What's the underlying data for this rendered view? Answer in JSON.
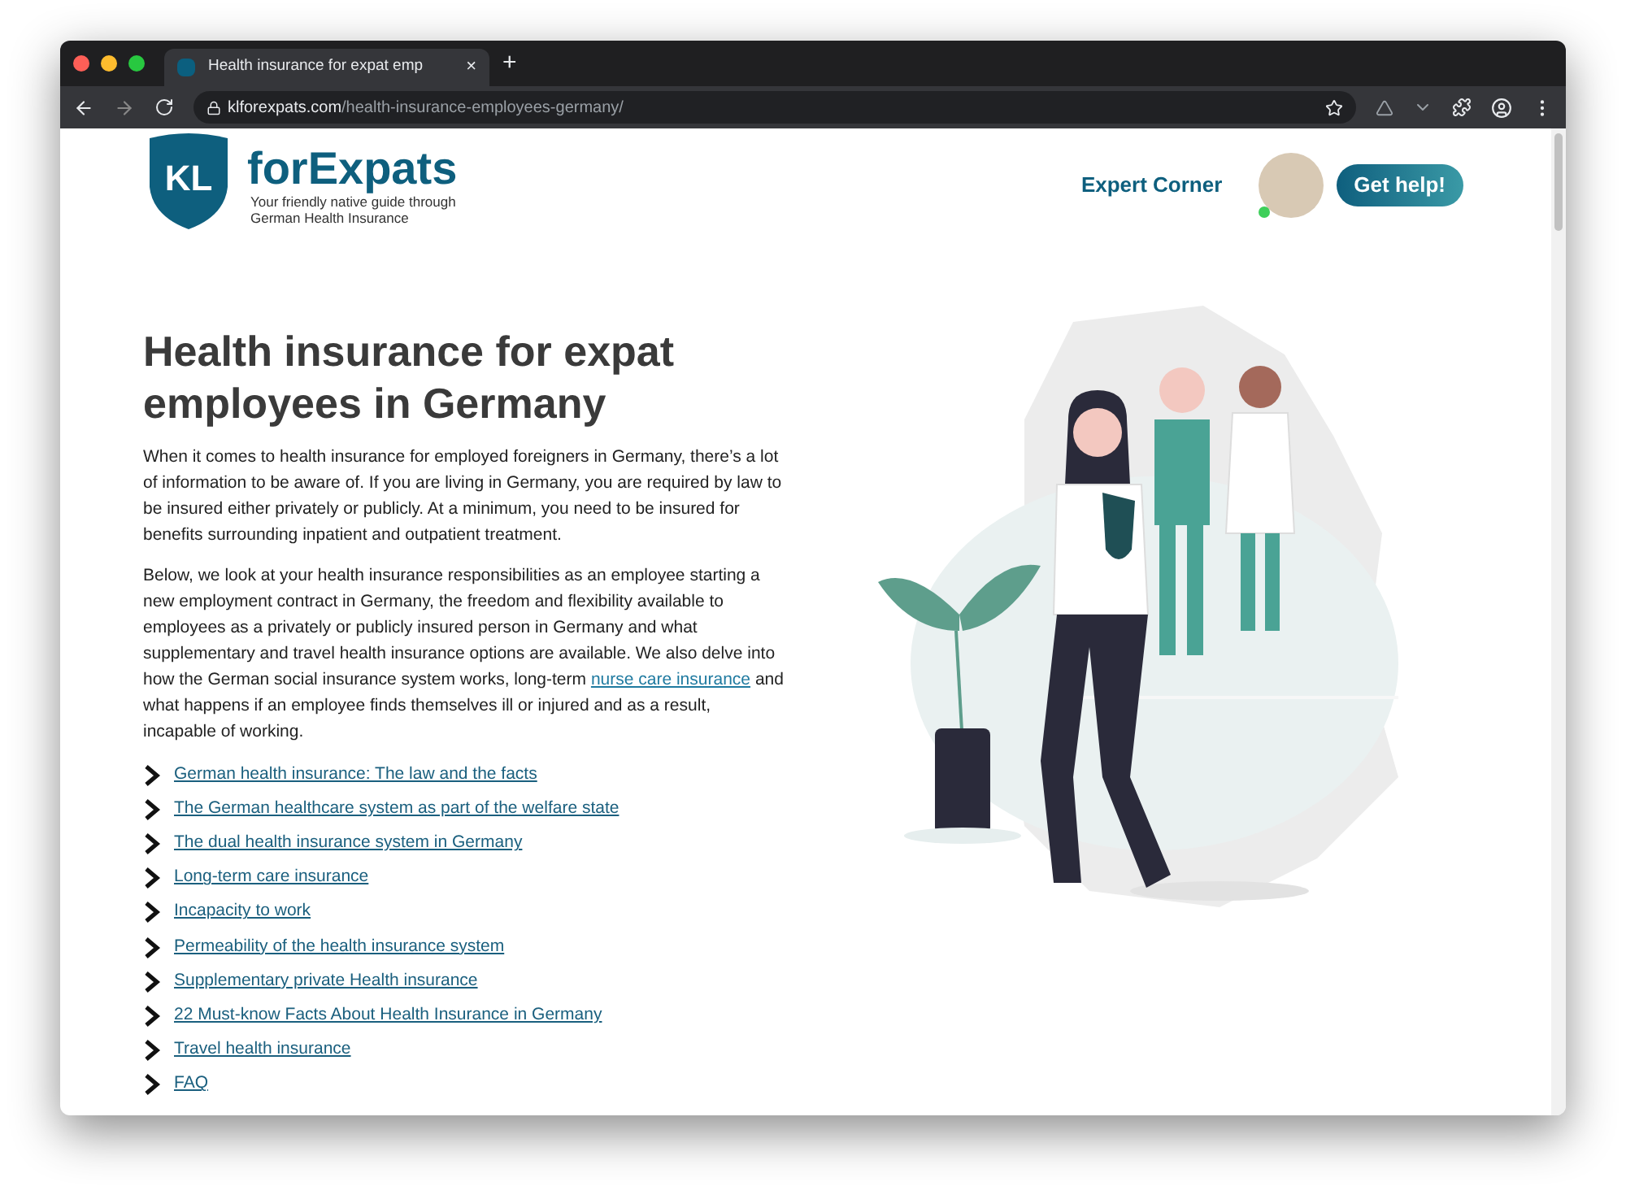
{
  "browser": {
    "tab_title": "Health insurance for expat emp",
    "tab_close": "×",
    "new_tab": "+",
    "url_domain": "klforexpats.com",
    "url_path": "/health-insurance-employees-germany/"
  },
  "header": {
    "logo_mark": "KL",
    "logo_name": "forExpats",
    "tagline_1": "Your friendly native guide through",
    "tagline_2": "German Health Insurance",
    "nav_link": "Expert Corner",
    "cta": "Get help!",
    "avatar_online": true
  },
  "article": {
    "title": "Health insurance for expat employees in Germany",
    "intro": "When it comes to health insurance for employed foreigners in Germany, there’s a lot of information to be aware of. If you are living in Germany, you are required by law to be insured either privately or publicly. At a minimum, you need to be insured for benefits surrounding inpatient and outpatient treatment.",
    "body_before_link": "Below, we look at your health insurance responsibilities as an employee starting a new employment contract in Germany, the freedom and flexibility available to employees as a privately or publicly insured person in Germany and what supplementary and travel health insurance options are available. We also delve into how the German social insurance system works, long-term",
    "body_link": "nurse care insurance",
    "body_after_link": "and what happens if an employee finds themselves ill or injured and as a result, incapable of working.",
    "toc": [
      "German health insurance: The law and the facts",
      "The German healthcare system as part of the welfare state",
      "The dual health insurance system in Germany",
      "Long-term care insurance",
      "Incapacity to work",
      "Permeability of the health insurance system",
      "Supplementary private Health insurance",
      "22 Must-know Facts About Health Insurance in Germany",
      "Travel health insurance",
      "FAQ"
    ]
  }
}
